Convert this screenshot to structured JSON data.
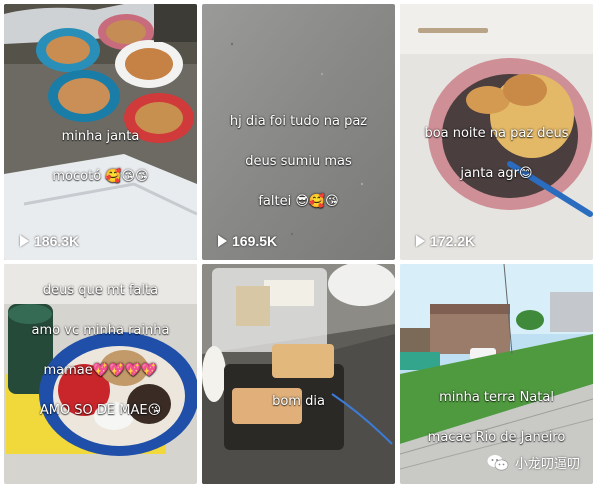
{
  "tiles": [
    {
      "caption_lines": [
        "minha janta",
        "mocotó 🥰😘😘"
      ],
      "views": "186.3K"
    },
    {
      "caption_lines": [
        "hj dia foi tudo na paz",
        "deus sumiu mas",
        "faltei 😎🥰😘"
      ],
      "views": "169.5K"
    },
    {
      "caption_lines": [
        "boa noite na paz deus",
        "janta agr😊"
      ],
      "views": "172.2K"
    },
    {
      "caption_lines": [
        "deus que mt falta",
        "amo vc minha rainha",
        "mamae💖💖💖💖",
        "AMO SO DE MAE😘"
      ]
    },
    {
      "caption_lines": [
        "bom dia"
      ]
    },
    {
      "caption_lines": [
        "minha terra Natal",
        "macae Rio de Janeiro"
      ]
    }
  ],
  "watermark": {
    "text": "小龙叨逼叨",
    "icon": "wechat-icon"
  },
  "icons": {
    "views": "play-icon"
  }
}
